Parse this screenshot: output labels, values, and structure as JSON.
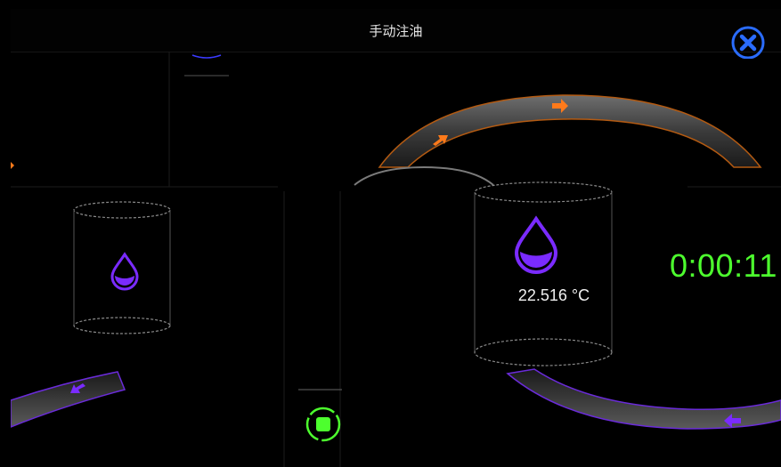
{
  "window": {
    "title": "手动注油",
    "close_icon": "close-circle-x-icon"
  },
  "tank_right": {
    "temperature": "22.516 °C",
    "icon": "oil-drop-icon"
  },
  "tank_left": {
    "icon": "oil-drop-icon"
  },
  "timer": {
    "elapsed": "0:00:11"
  },
  "controls": {
    "stop_icon": "stop-square-icon"
  },
  "colors": {
    "accent_green": "#4dff2e",
    "oil_purple": "#7a2bff",
    "flow_orange": "#ff7a1a",
    "pipe_gray": "#555555"
  }
}
